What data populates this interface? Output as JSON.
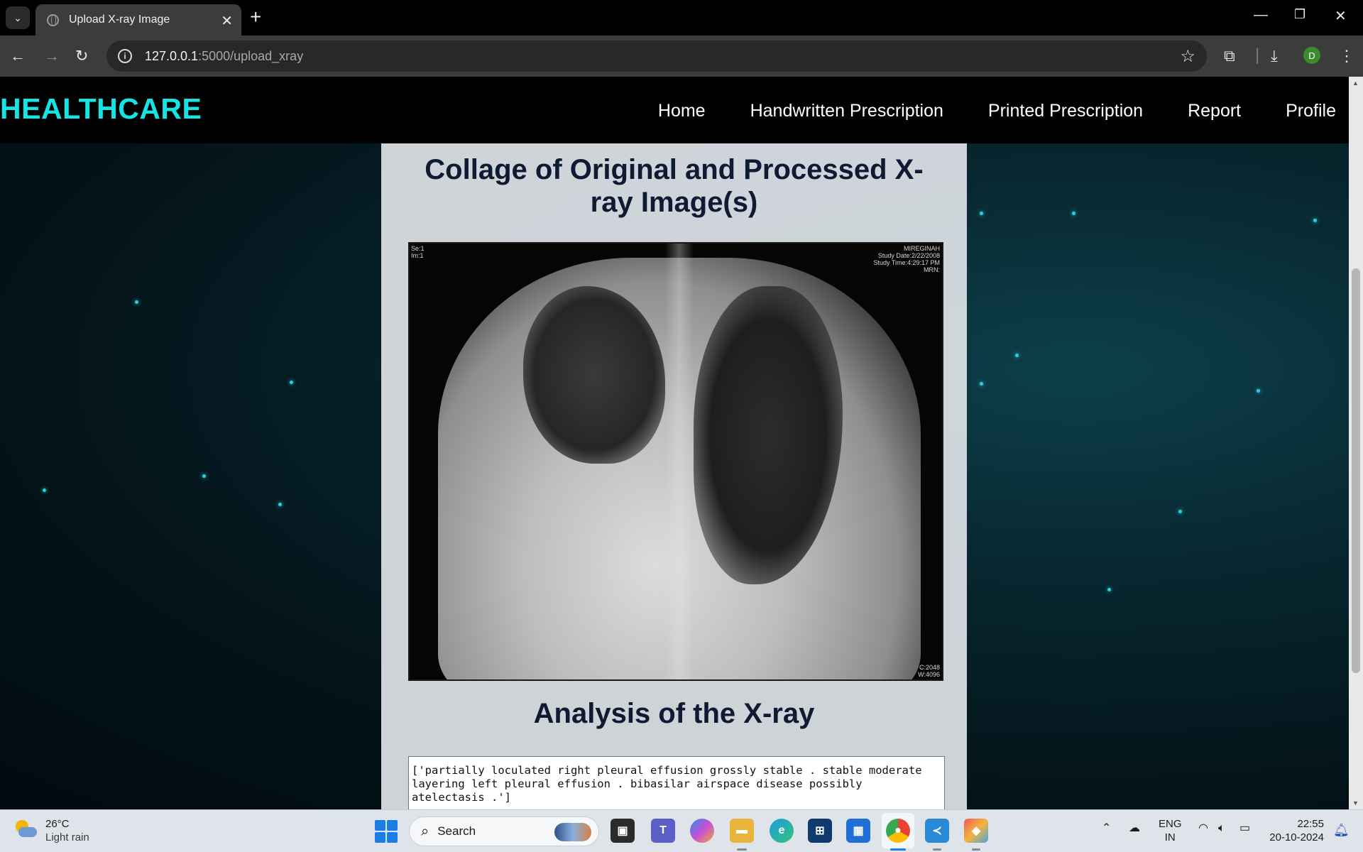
{
  "browser": {
    "tab_title": "Upload X-ray Image",
    "url_host": "127.0.0.1",
    "url_path": ":5000/upload_xray",
    "profile_initial": "D",
    "icons": [
      "tab-list-icon",
      "globe-icon",
      "close-icon",
      "plus-icon",
      "back-icon",
      "forward-icon",
      "reload-icon",
      "info-icon",
      "star-icon",
      "extensions-icon",
      "download-icon",
      "kebab-menu-icon",
      "minimize-icon",
      "restore-icon",
      "window-close-icon"
    ]
  },
  "site": {
    "logo": "HEALTHCARE",
    "nav": [
      "Home",
      "Handwritten Prescription",
      "Printed Prescription",
      "Report",
      "Profile"
    ],
    "collage_heading": "Collage of Original and Processed X-ray Image(s)",
    "xray": {
      "meta_top_left": [
        "Se:1",
        "Im:1"
      ],
      "meta_top_right": [
        "MIREGINAH",
        "Study Date:2/22/2008",
        "Study Time:4:29:17 PM",
        "MRN:"
      ],
      "meta_bottom_right": [
        "C:2048",
        "W:4096"
      ]
    },
    "analysis_heading": "Analysis of the X-ray",
    "analysis_text": "['partially loculated right pleural effusion grossly stable . stable moderate layering left pleural effusion . bibasilar airspace disease possibly atelectasis .']"
  },
  "taskbar": {
    "temperature": "26°C",
    "condition": "Light rain",
    "search_label": "Search",
    "lang": "ENG",
    "region": "IN",
    "time": "22:55",
    "date": "20-10-2024",
    "accent": "#1d7de6"
  }
}
